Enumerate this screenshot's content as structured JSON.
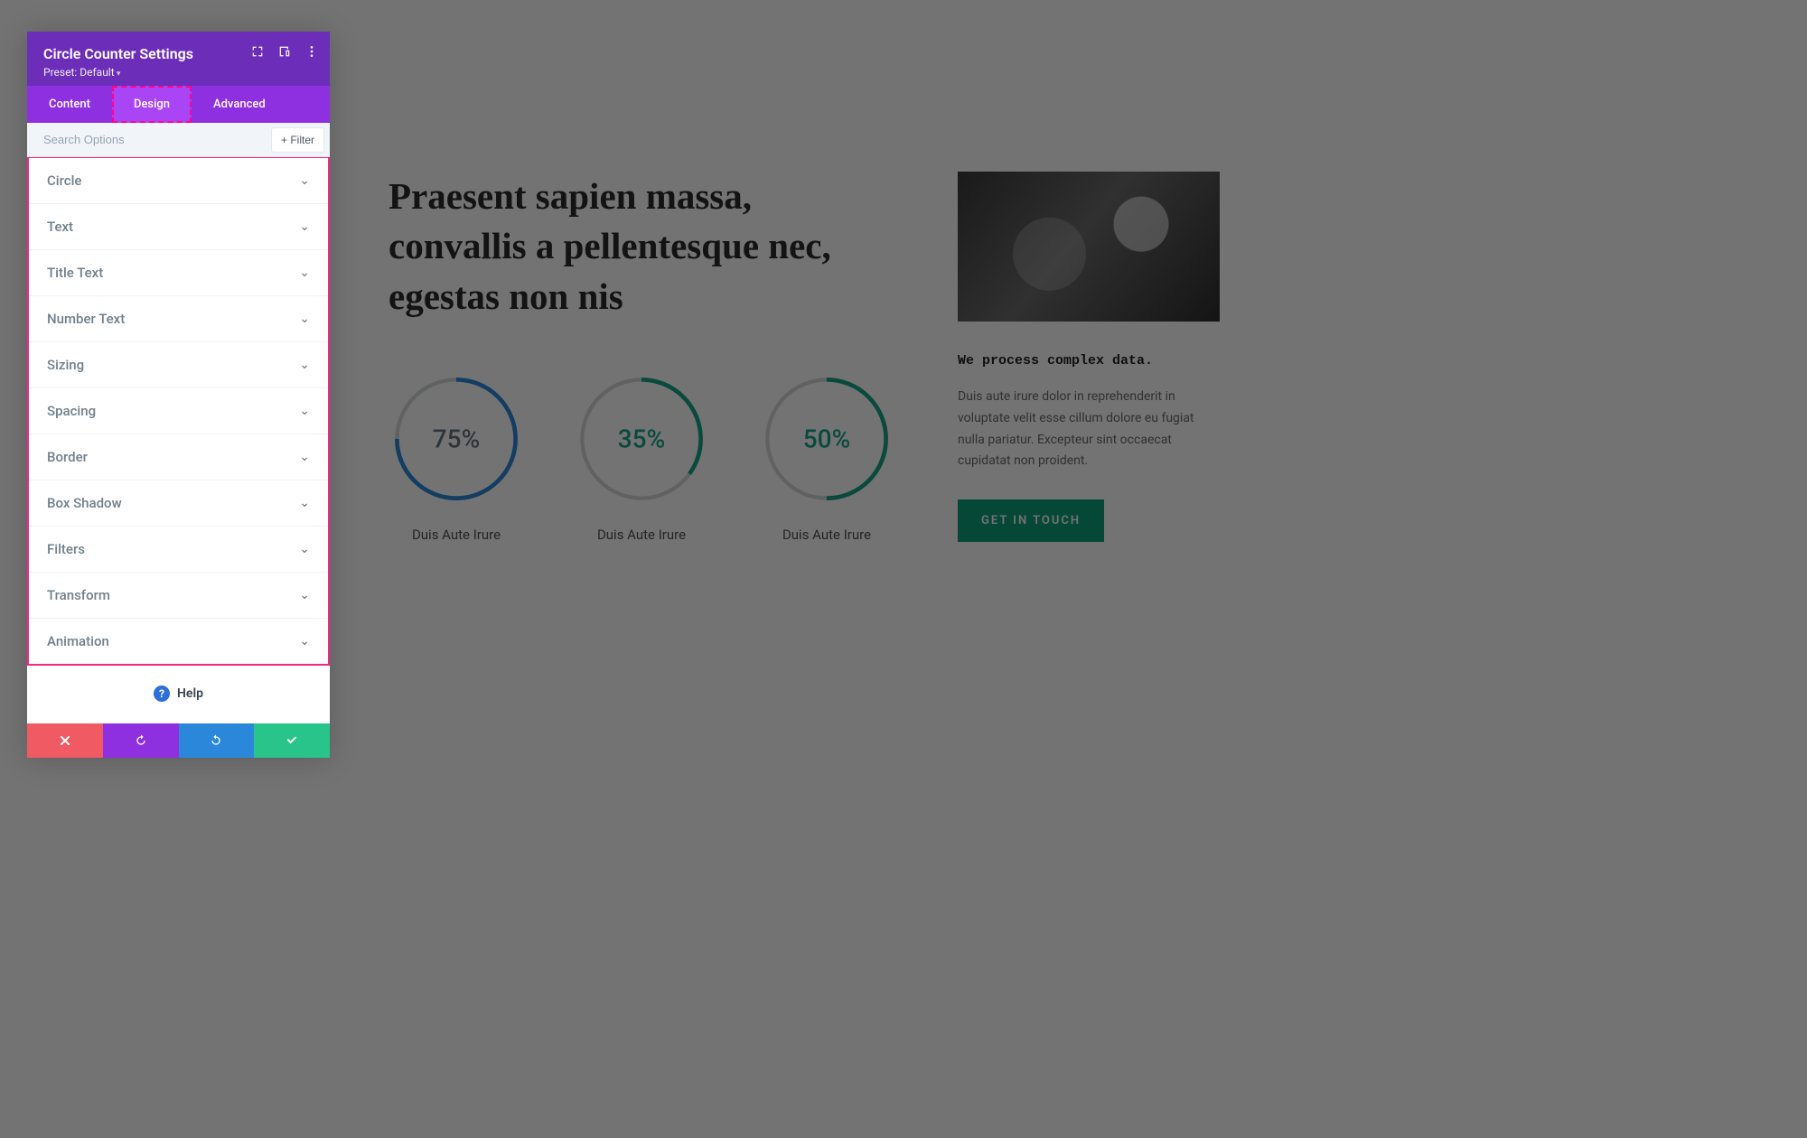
{
  "panel": {
    "title": "Circle Counter Settings",
    "preset": "Preset: Default",
    "tabs": [
      {
        "label": "Content",
        "active": false
      },
      {
        "label": "Design",
        "active": true
      },
      {
        "label": "Advanced",
        "active": false
      }
    ],
    "search_placeholder": "Search Options",
    "filter_label": "Filter",
    "sections": [
      "Circle",
      "Text",
      "Title Text",
      "Number Text",
      "Sizing",
      "Spacing",
      "Border",
      "Box Shadow",
      "Filters",
      "Transform",
      "Animation"
    ],
    "help_label": "Help"
  },
  "footer_icons": [
    "cancel",
    "undo",
    "redo",
    "save"
  ],
  "preview": {
    "headline": "Praesent sapien massa, convallis a pellentesque nec, egestas non nis",
    "counters": [
      {
        "value": "75%",
        "pct": 75,
        "color": "#2b87da",
        "value_color": "#6b7680",
        "title": "Duis Aute Irure"
      },
      {
        "value": "35%",
        "pct": 35,
        "color": "#17a589",
        "value_color": "#17a589",
        "title": "Duis Aute Irure"
      },
      {
        "value": "50%",
        "pct": 50,
        "color": "#17a589",
        "value_color": "#17a589",
        "title": "Duis Aute Irure"
      }
    ],
    "side": {
      "subtitle": "We process complex data.",
      "body": "Duis aute irure dolor in reprehenderit in voluptate velit esse cillum dolore eu fugiat nulla pariatur. Excepteur sint occaecat cupidatat non proident.",
      "cta": "GET IN TOUCH"
    }
  },
  "colors": {
    "panel_purple": "#6c2eb9",
    "tab_purple": "#8e30e0",
    "highlight_pink": "#ec2a86"
  }
}
